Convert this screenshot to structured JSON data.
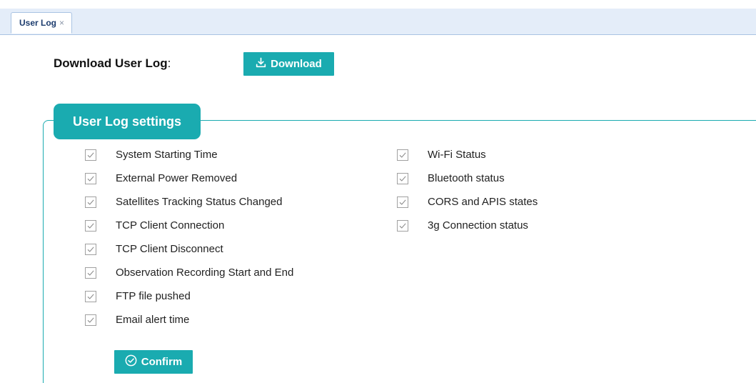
{
  "tab": {
    "label": "User Log",
    "close": "×"
  },
  "download": {
    "label": "Download User Log",
    "colon": ":",
    "button": "Download"
  },
  "settings": {
    "title": "User Log settings",
    "left_items": [
      {
        "label": "System Starting Time",
        "checked": true
      },
      {
        "label": "External Power Removed",
        "checked": true
      },
      {
        "label": "Satellites Tracking Status Changed",
        "checked": true
      },
      {
        "label": "TCP Client Connection",
        "checked": true
      },
      {
        "label": "TCP Client Disconnect",
        "checked": true
      },
      {
        "label": "Observation Recording Start and End",
        "checked": true
      },
      {
        "label": "FTP file pushed",
        "checked": true
      },
      {
        "label": "Email alert time",
        "checked": true
      }
    ],
    "right_items": [
      {
        "label": "Wi-Fi Status",
        "checked": true
      },
      {
        "label": "Bluetooth status",
        "checked": true
      },
      {
        "label": "CORS and APIS states",
        "checked": true
      },
      {
        "label": "3g Connection status",
        "checked": true
      }
    ],
    "confirm": "Confirm"
  },
  "colors": {
    "accent": "#1aabb0",
    "tab_bar": "#e4edf9"
  },
  "icons": {
    "download": "download-icon",
    "confirm": "check-circle-icon",
    "checkbox": "checkmark-icon"
  }
}
